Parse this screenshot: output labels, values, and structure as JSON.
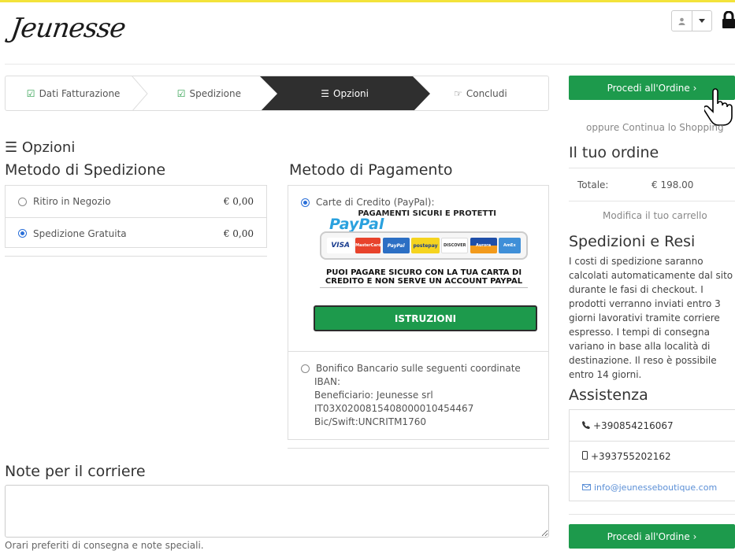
{
  "header": {
    "logo_text": "Jeunesse",
    "user_icon": "user-icon",
    "caret_icon": "caret-down-icon",
    "lock_icon": "lock-icon"
  },
  "steps": [
    {
      "label": "Dati Fatturazione",
      "icon": "check-square-icon",
      "icon_glyph": "☑",
      "state": "done"
    },
    {
      "label": "Spedizione",
      "icon": "check-square-icon",
      "icon_glyph": "☑",
      "state": "done"
    },
    {
      "label": "Opzioni",
      "icon": "list-icon",
      "icon_glyph": "☰",
      "state": "active"
    },
    {
      "label": "Concludi",
      "icon": "hand-point-right-icon",
      "icon_glyph": "☞",
      "state": "pending"
    }
  ],
  "options": {
    "heading": "Opzioni",
    "heading_icon": "list-icon"
  },
  "shipping": {
    "heading": "Metodo di Spedizione",
    "methods": [
      {
        "label": "Ritiro in Negozio",
        "price": "€ 0,00",
        "selected": false
      },
      {
        "label": "Spedizione Gratuita",
        "price": "€ 0,00",
        "selected": true
      }
    ]
  },
  "payment": {
    "heading": "Metodo di Pagamento",
    "credit_card_label": "Carte di Credito (PayPal):",
    "credit_card_selected": true,
    "paypal_banner_top": "PAGAMENTI SICURI E PROTETTI",
    "paypal_logo": "PayPal",
    "card_logos": [
      "VISA",
      "MasterCard",
      "PayPal",
      "postepay",
      "DISCOVER",
      "Aurora",
      "AmEx"
    ],
    "paypal_message_line1": "PUOI PAGARE SICURO CON LA TUA CARTA DI",
    "paypal_message_line2": "CREDITO E NON SERVE UN ACCOUNT PAYPAL",
    "instructions_button": "ISTRUZIONI",
    "bank_transfer": {
      "selected": false,
      "lines": [
        "Bonifico Bancario sulle seguenti coordinate",
        "IBAN:",
        "Beneficiario: Jeunesse srl",
        "IT03X0200815408000010454467",
        "Bic/Swift:UNCRITM1760"
      ]
    }
  },
  "notes": {
    "heading": "Note per il corriere",
    "value": "",
    "help": "Orari preferiti di consegna e note speciali."
  },
  "sidebar": {
    "proceed_button": "Procedi all'Ordine ›",
    "continue_shopping": "oppure Continua lo Shopping",
    "order_heading": "Il tuo ordine",
    "total_label": "Totale:",
    "total_value": "€ 198.00",
    "edit_cart": "Modifica il tuo carrello",
    "shipping_returns_heading": "Spedizioni e Resi",
    "shipping_returns_text": "I costi di spedizione saranno calcolati automaticamente dal sito durante le fasi di checkout. I prodotti verranno inviati entro 3 giorni lavorativi tramite corriere espresso. I tempi di consegna variano in base alla località di destinazione. Il reso è possibile entro 14 giorni.",
    "assistance_heading": "Assistenza",
    "phone": "+390854216067",
    "mobile": "+393755202162",
    "email": "info@jeunesseboutique.com",
    "proceed_button_bottom": "Procedi all'Ordine ›"
  },
  "colors": {
    "accent_green": "#1d9a4c",
    "active_step": "#2f2f2f",
    "link_blue": "#5b8fd6",
    "top_bar": "#f3e33a"
  }
}
